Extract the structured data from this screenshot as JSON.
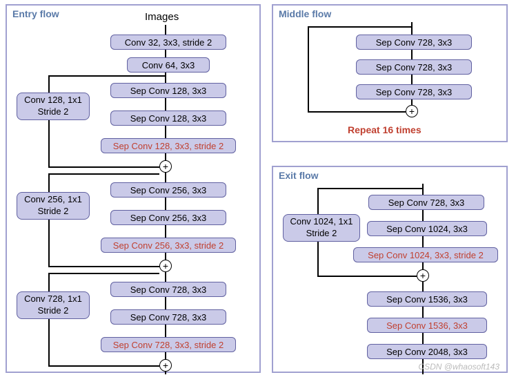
{
  "entry": {
    "title": "Entry  flow",
    "images_label": "Images",
    "main_blocks": [
      {
        "text": "Conv 32, 3x3, stride 2",
        "red": false
      },
      {
        "text": "Conv 64, 3x3",
        "red": false
      },
      {
        "text": "Sep Conv 128, 3x3",
        "red": false
      },
      {
        "text": "Sep Conv 128, 3x3",
        "red": false
      },
      {
        "text": "Sep Conv 128, 3x3, stride 2",
        "red": true
      },
      {
        "text": "Sep Conv 256, 3x3",
        "red": false
      },
      {
        "text": "Sep Conv 256, 3x3",
        "red": false
      },
      {
        "text": "Sep Conv 256, 3x3, stride 2",
        "red": true
      },
      {
        "text": "Sep Conv 728, 3x3",
        "red": false
      },
      {
        "text": "Sep Conv 728, 3x3",
        "red": false
      },
      {
        "text": "Sep Conv 728, 3x3, stride 2",
        "red": true
      }
    ],
    "side_blocks": [
      "Conv 128, 1x1\nStride 2",
      "Conv 256, 1x1\nStride 2",
      "Conv 728, 1x1\nStride 2"
    ]
  },
  "middle": {
    "title": "Middle  flow",
    "blocks": [
      "Sep Conv 728, 3x3",
      "Sep Conv 728, 3x3",
      "Sep Conv 728, 3x3"
    ],
    "repeat_label": "Repeat 16 times"
  },
  "exit": {
    "title": "Exit  flow",
    "side_block": "Conv 1024, 1x1\nStride 2",
    "blocks": [
      {
        "text": "Sep Conv 728, 3x3",
        "red": false
      },
      {
        "text": "Sep Conv 1024, 3x3",
        "red": false
      },
      {
        "text": "Sep Conv 1024, 3x3, stride 2",
        "red": true
      },
      {
        "text": "Sep Conv 1536, 3x3",
        "red": false
      },
      {
        "text": "Sep Conv 1536, 3x3",
        "red": true
      },
      {
        "text": "Sep Conv 2048, 3x3",
        "red": false
      }
    ]
  },
  "watermark": "CSDN @whaosoft143"
}
